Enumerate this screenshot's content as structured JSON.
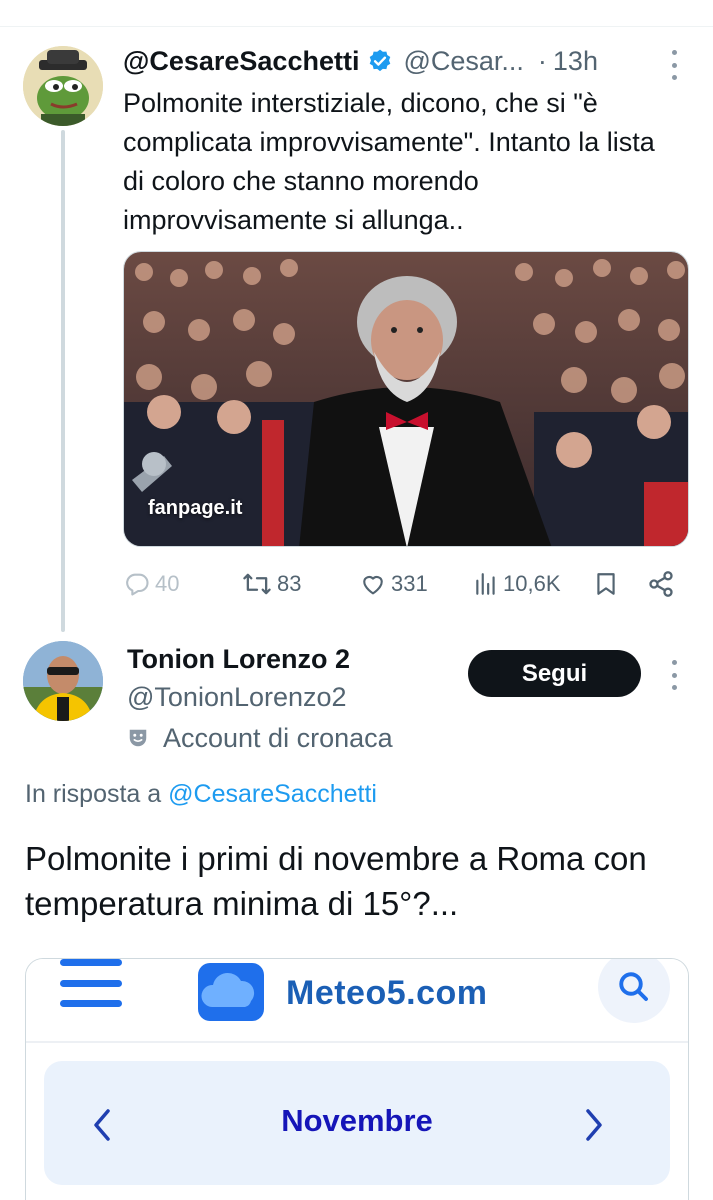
{
  "parent_tweet": {
    "display_name": "@CesareSacchetti",
    "handle": "@Cesar...",
    "separator": "·",
    "time": "13h",
    "text": "Polmonite interstiziale, dicono, che si \"è complicata improvvisamente\". Intanto la lista di coloro che stanno morendo improvvisamente si allunga..",
    "media_watermark": "fanpage.it",
    "actions": {
      "replies": "40",
      "retweets": "83",
      "likes": "331",
      "views": "10,6K"
    }
  },
  "reply_tweet": {
    "display_name": "Tonion Lorenzo 2",
    "handle": "@TonionLorenzo2",
    "account_label": "Account di cronaca",
    "follow_label": "Segui",
    "reply_prefix": "In risposta a",
    "reply_mention": "@CesareSacchetti",
    "text": "Polmonite i primi di novembre a Roma con temperatura minima  di 15°?...",
    "embedded_site": {
      "logo_text": "Meteo5.com",
      "month": "Novembre"
    }
  },
  "colors": {
    "accent_blue": "#1d9bf0",
    "secondary_text": "#536471",
    "site_blue": "#1b5fb5",
    "month_text": "#1515b8"
  },
  "icons": {
    "verified": "verified-badge-icon",
    "more": "kebab-menu-icon",
    "reply": "reply-icon",
    "retweet": "retweet-icon",
    "like": "heart-icon",
    "views": "views-bar-icon",
    "bookmark": "bookmark-icon",
    "share": "share-icon",
    "label": "theater-mask-icon",
    "menu": "hamburger-icon",
    "search": "search-icon",
    "prev": "chevron-left-icon",
    "next": "chevron-right-icon"
  }
}
